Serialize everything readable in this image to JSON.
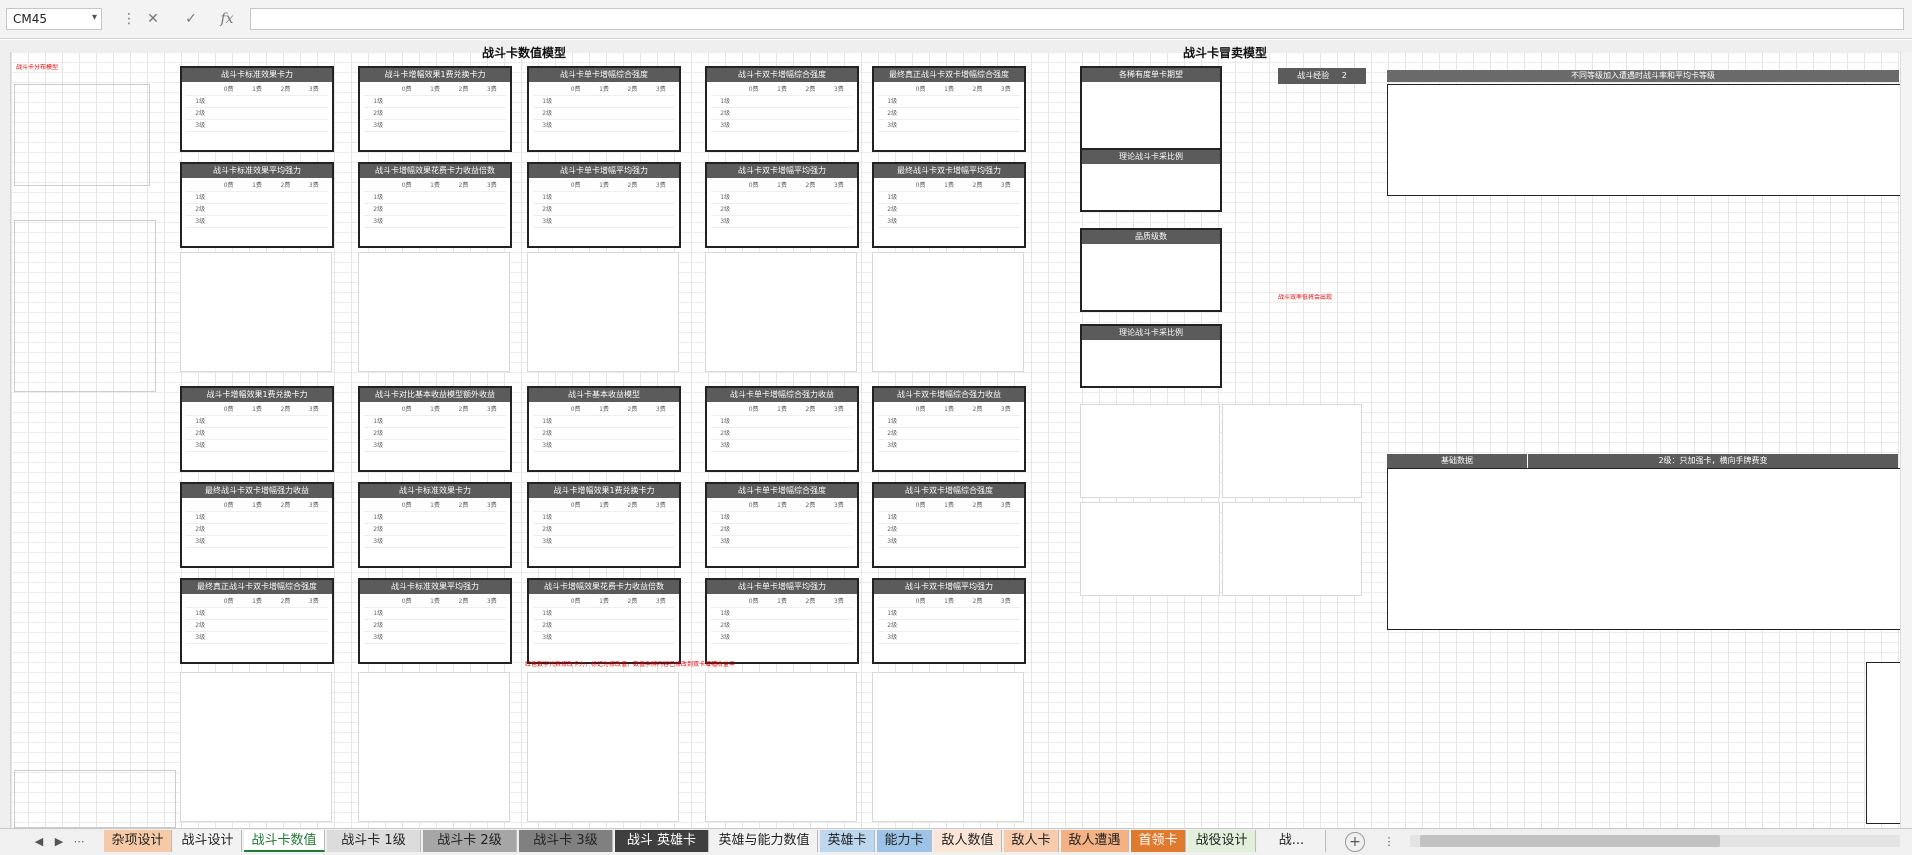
{
  "formula_bar": {
    "name_box": "CM45",
    "cancel_icon": "✕",
    "enter_icon": "✓",
    "fx_label": "fx",
    "formula": ""
  },
  "models": {
    "left_title": "战斗卡数值模型",
    "right_title": "战斗卡冒卖模型"
  },
  "tables_left": [
    "战斗卡标准效果卡力",
    "战斗卡增幅效果1费兑换卡力",
    "战斗卡单卡增幅综合强度",
    "战斗卡双卡增幅综合强度",
    "最终真正战斗卡双卡增幅综合强度",
    "战斗卡标准效果平均强力",
    "战斗卡增幅效果花费卡力收益倍数",
    "战斗卡单卡增幅平均强力",
    "战斗卡双卡增幅平均强力",
    "最终战斗卡双卡增幅平均强力",
    "战斗卡增幅效果1费兑换卡力",
    "战斗卡对比基本收益模型额外收益",
    "战斗卡基本收益模型",
    "战斗卡单卡增幅综合强力收益",
    "战斗卡双卡增幅综合强力收益",
    "最终战斗卡双卡增幅强力收益"
  ],
  "tables_right": [
    "各稀有度单卡期望",
    "理论战斗卡采比例",
    "品质级数",
    "理论战斗卡采比例"
  ],
  "level_labels": [
    "1级",
    "2级",
    "3级"
  ],
  "col_labels": [
    "0费",
    "1费",
    "2费",
    "3费"
  ],
  "right_panel": {
    "header": "战斗经验",
    "header_value": "2",
    "section_title": "不同等级加入遭遇时战斗率和平均卡等级",
    "basic_data_label": "基础数据",
    "cost_table_title": "2级：只加强卡，横向手牌费变"
  },
  "red_notes": [
    "战斗卡分布模型",
    "红色数字代表修改卡力，标记为修改值，数值手牌内容已修改到双卡增幅收益中",
    "出牌",
    "战斗效率低将会出现"
  ],
  "tabs": [
    {
      "label": "杂项设计",
      "bg": "#f7caa7"
    },
    {
      "label": "战斗设计",
      "bg": "#f2f2f2"
    },
    {
      "label": "战斗卡数值",
      "bg": "#ffffff",
      "active": true
    },
    {
      "label": "战斗卡 1级",
      "bg": "#dcdcdc"
    },
    {
      "label": "战斗卡 2级",
      "bg": "#a6a6a6"
    },
    {
      "label": "战斗卡 3级",
      "bg": "#808080"
    },
    {
      "label": "战斗 英雄卡",
      "bg": "#3f3f3f",
      "dark": true
    },
    {
      "label": "英雄与能力数值",
      "bg": "#f2f2f2"
    },
    {
      "label": "英雄卡",
      "bg": "#bdd7ee"
    },
    {
      "label": "能力卡",
      "bg": "#9dc3e6"
    },
    {
      "label": "敌人数值",
      "bg": "#fce4d6"
    },
    {
      "label": "敌人卡",
      "bg": "#f8cbad"
    },
    {
      "label": "敌人遭遇",
      "bg": "#f4b183"
    },
    {
      "label": "首领卡",
      "bg": "#e07a2e",
      "dark": true
    },
    {
      "label": "战役设计",
      "bg": "#e2efda"
    },
    {
      "label": "战...",
      "bg": "#f2f2f2"
    }
  ],
  "nav_icons": [
    "prev-sheet",
    "next-sheet"
  ]
}
